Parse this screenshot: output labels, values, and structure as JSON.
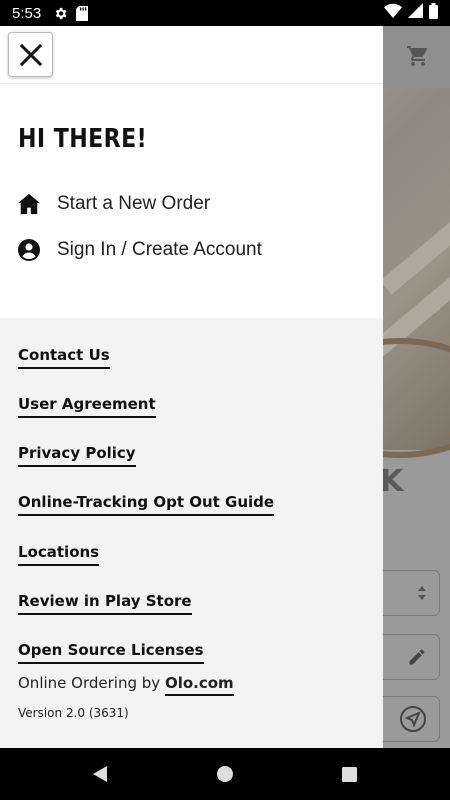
{
  "status_bar": {
    "time": "5:53",
    "icons": [
      "gear-icon",
      "sd-card-icon",
      "wifi-icon",
      "signal-icon",
      "battery-icon"
    ]
  },
  "drawer": {
    "greeting": "HI THERE!",
    "actions": [
      {
        "label": "Start a New Order",
        "icon": "home-icon"
      },
      {
        "label": "Sign In / Create Account",
        "icon": "account-icon"
      }
    ],
    "links": [
      "Contact Us",
      "User Agreement",
      "Privacy Policy",
      "Online-Tracking Opt Out Guide",
      "Locations",
      "Review in Play Store",
      "Open Source Licenses"
    ],
    "footer": {
      "ordering_prefix": "Online Ordering by",
      "ordering_link": "Olo.com",
      "version": "Version 2.0 (3631)"
    }
  },
  "background": {
    "partial_heading": "K"
  },
  "nav_bar": {
    "buttons": [
      "back-icon",
      "home-circle-icon",
      "recents-square-icon"
    ]
  },
  "colors": {
    "drawer_top": "#ffffff",
    "drawer_bottom": "#f3f3f3",
    "text": "#111111",
    "scrim": "#9a9a9a"
  }
}
